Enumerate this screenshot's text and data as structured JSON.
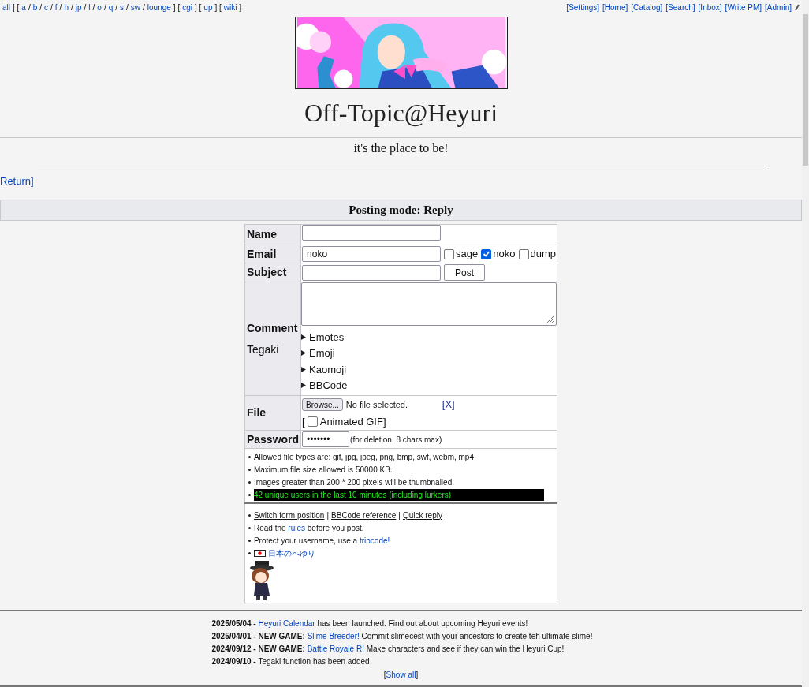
{
  "top_nav": {
    "left": [
      {
        "kind": "link",
        "text": "all"
      },
      {
        "kind": "text",
        "text": "] ["
      },
      {
        "kind": "link",
        "text": "a"
      },
      {
        "kind": "text",
        "text": "/"
      },
      {
        "kind": "link",
        "text": "b"
      },
      {
        "kind": "text",
        "text": "/"
      },
      {
        "kind": "link",
        "text": "c"
      },
      {
        "kind": "text",
        "text": "/"
      },
      {
        "kind": "link",
        "text": "f"
      },
      {
        "kind": "text",
        "text": "/"
      },
      {
        "kind": "link",
        "text": "h"
      },
      {
        "kind": "text",
        "text": "/"
      },
      {
        "kind": "link",
        "text": "jp"
      },
      {
        "kind": "text",
        "text": "/"
      },
      {
        "kind": "link",
        "text": "l"
      },
      {
        "kind": "text",
        "text": "/"
      },
      {
        "kind": "link",
        "text": "o"
      },
      {
        "kind": "text",
        "text": "/"
      },
      {
        "kind": "link",
        "text": "q"
      },
      {
        "kind": "text",
        "text": "/"
      },
      {
        "kind": "link",
        "text": "s"
      },
      {
        "kind": "text",
        "text": "/"
      },
      {
        "kind": "link",
        "text": "sw"
      },
      {
        "kind": "text",
        "text": "/"
      },
      {
        "kind": "link",
        "text": "lounge"
      },
      {
        "kind": "text",
        "text": "] ["
      },
      {
        "kind": "link",
        "text": "cgi"
      },
      {
        "kind": "text",
        "text": "] ["
      },
      {
        "kind": "link",
        "text": "up"
      },
      {
        "kind": "text",
        "text": "] ["
      },
      {
        "kind": "link",
        "text": "wiki"
      },
      {
        "kind": "text",
        "text": "]"
      }
    ],
    "right": [
      "[Settings]",
      "[Home]",
      "[Catalog]",
      "[Search]",
      "[Inbox]",
      "[Write PM]",
      "[Admin]"
    ]
  },
  "header": {
    "title": "Off-Topic@Heyuri",
    "subtitle": "it's the place to be!"
  },
  "return": {
    "link": "Return",
    "close": "]"
  },
  "mode_bar": "Posting mode: Reply",
  "form": {
    "name": {
      "label": "Name"
    },
    "email": {
      "label": "Email",
      "value": "noko",
      "options": [
        {
          "label": "sage",
          "checked": false
        },
        {
          "label": "noko",
          "checked": true
        },
        {
          "label": "dump",
          "checked": false
        }
      ]
    },
    "subject": {
      "label": "Subject",
      "button": "Post"
    },
    "comment": {
      "labels": [
        "Comment",
        "Tegaki"
      ],
      "sections": [
        {
          "label": "Emotes",
          "expanded": false
        },
        {
          "label": "Emoji",
          "expanded": false
        },
        {
          "label": "Kaomoji",
          "expanded": false
        },
        {
          "label": "BBCode",
          "expanded": false
        }
      ]
    },
    "file": {
      "label": "File",
      "browse": "Browse...",
      "status": "No file selected.",
      "clear": "[X]",
      "animated": {
        "prefix": "[",
        "label": "Animated GIF]",
        "checked": false
      }
    },
    "password": {
      "label": "Password",
      "value": "•••••••",
      "hint": "(for deletion, 8 chars max)"
    },
    "rules": [
      {
        "kind": "plain",
        "text": "Allowed file types are: gif, jpg, jpeg, png, bmp, swf, webm, mp4"
      },
      {
        "kind": "plain",
        "text": "Maximum file size allowed is 50000 KB."
      },
      {
        "kind": "plain",
        "text": "Images greater than 200 * 200 pixels will be thumbnailed."
      },
      {
        "kind": "highlight",
        "text": "42 unique users in the last 10 minutes (including lurkers)"
      }
    ],
    "info": [
      {
        "kind": "links",
        "links": [
          "Switch form position",
          "BBCode reference",
          "Quick reply"
        ],
        "separator": "|"
      },
      {
        "kind": "sentence",
        "parts": [
          {
            "text": "Read the "
          },
          {
            "link": "rules"
          },
          {
            "text": " before you post."
          }
        ]
      },
      {
        "kind": "sentence",
        "parts": [
          {
            "text": "Protect your username, use a "
          },
          {
            "link": "tripcode!"
          }
        ]
      },
      {
        "kind": "flag",
        "link": "日本のへゆり"
      }
    ]
  },
  "news": [
    {
      "parts": [
        {
          "bold": "2025/05/04 - "
        },
        {
          "link": "Heyuri Calendar"
        },
        {
          "text": " has been launched. Find out about upcoming Heyuri events!"
        }
      ]
    },
    {
      "parts": [
        {
          "bold": "2025/04/01 - NEW GAME: "
        },
        {
          "link": "Slime Breeder!"
        },
        {
          "text": " Commit slimecest with your ancestors to create teh ultimate slime!"
        }
      ]
    },
    {
      "parts": [
        {
          "bold": "2024/09/12 - NEW GAME: "
        },
        {
          "link": "Battle Royale R!"
        },
        {
          "text": " Make characters and see if they can win the Heyuri Cup!"
        }
      ]
    },
    {
      "parts": [
        {
          "bold": "2024/09/10 - "
        },
        {
          "text": "Tegaki function has been added"
        }
      ]
    }
  ],
  "show_all": {
    "open": "[",
    "link": "Show all",
    "close": "]"
  }
}
